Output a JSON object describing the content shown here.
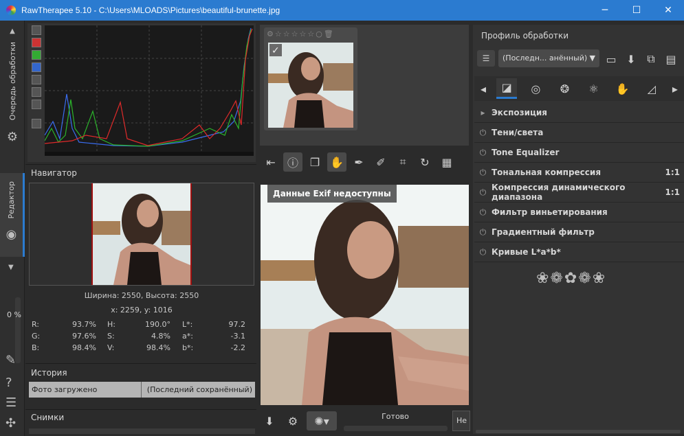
{
  "window": {
    "title": "RawTherapee 5.10 - C:\\Users\\MLOADS\\Pictures\\beautiful-brunette.jpg",
    "minimize": "─",
    "maximize": "☐",
    "close": "✕"
  },
  "left_strip": {
    "queue_tab": "Очередь обработки",
    "editor_tab": "Редактор",
    "zoom_percent": "0 %"
  },
  "navigator": {
    "title": "Навигатор",
    "size_text": "Ширина: 2550, Высота: 2550",
    "coords_text": "x: 2259, y: 1016",
    "values": {
      "rgb": [
        [
          "R:",
          "93.7%"
        ],
        [
          "G:",
          "97.6%"
        ],
        [
          "B:",
          "98.4%"
        ]
      ],
      "hsv": [
        [
          "H:",
          "190.0°"
        ],
        [
          "S:",
          "4.8%"
        ],
        [
          "V:",
          "98.4%"
        ]
      ],
      "lab": [
        [
          "L*:",
          "97.2"
        ],
        [
          "a*:",
          "-3.1"
        ],
        [
          "b*:",
          "-2.2"
        ]
      ]
    }
  },
  "history": {
    "title": "История",
    "item_left": "Фото загружено",
    "item_right": "(Последний сохранённый)"
  },
  "snapshots": {
    "title": "Снимки"
  },
  "preview": {
    "exif_overlay": "Данные Exif недоступны",
    "status": "Готово",
    "cut_button": "Не"
  },
  "profile": {
    "title": "Профиль обработки",
    "selected": "(Последн... анённый)"
  },
  "tools": [
    {
      "label": "Экспозиция",
      "extra": "",
      "expander": true
    },
    {
      "label": "Тени/света",
      "extra": ""
    },
    {
      "label": "Tone Equalizer",
      "extra": ""
    },
    {
      "label": "Тональная компрессия",
      "extra": "1:1"
    },
    {
      "label": "Компрессия динамического диапазона",
      "extra": "1:1"
    },
    {
      "label": "Фильтр виньетирования",
      "extra": ""
    },
    {
      "label": "Градиентный фильтр",
      "extra": ""
    },
    {
      "label": "Кривые L*a*b*",
      "extra": ""
    }
  ],
  "icons": {
    "power": "⏻",
    "expander": "▸",
    "ornament": "❀❁✿❁❀"
  },
  "colors": {
    "accent": "#2b7bd0"
  }
}
